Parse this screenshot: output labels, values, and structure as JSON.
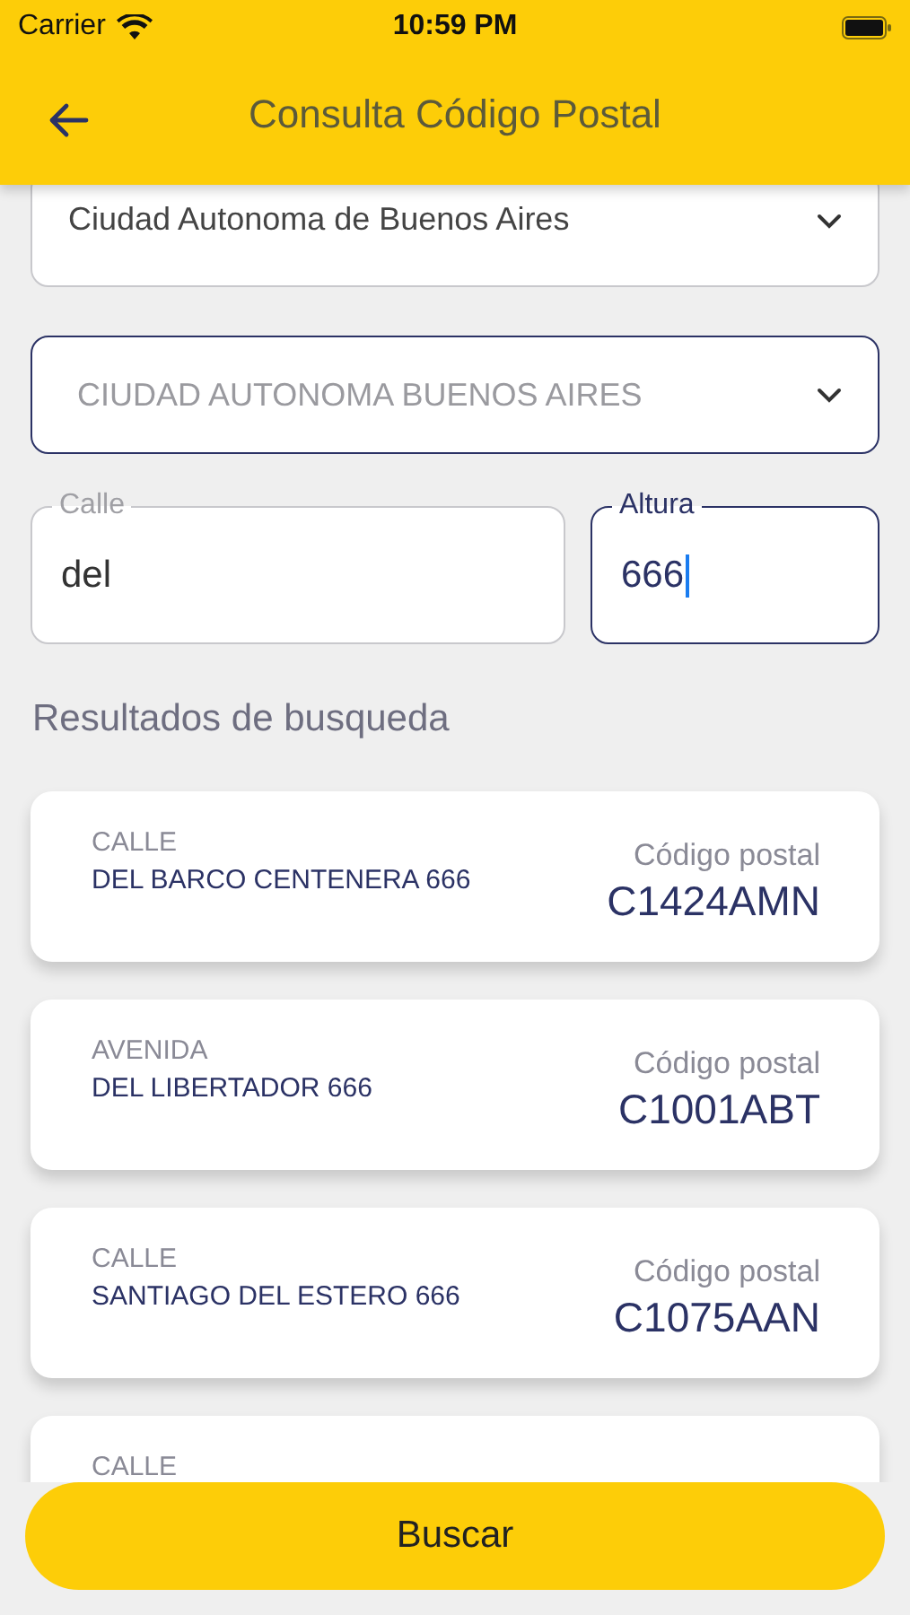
{
  "status_bar": {
    "carrier": "Carrier",
    "time": "10:59 PM"
  },
  "header": {
    "title": "Consulta Código Postal"
  },
  "province_select": {
    "value": "Ciudad Autonoma de Buenos Aires",
    "focused": false
  },
  "locality_select": {
    "value": "CIUDAD AUTONOMA BUENOS AIRES",
    "focused": true
  },
  "fields": [
    {
      "label": "Calle",
      "value": "del",
      "focused": false
    },
    {
      "label": "Altura",
      "value": "666",
      "focused": true
    }
  ],
  "results_heading": "Resultados de busqueda",
  "results": [
    {
      "type": "CALLE",
      "street": "DEL BARCO CENTENERA 666",
      "postal_label": "Código postal",
      "postal_code": "C1424AMN"
    },
    {
      "type": "AVENIDA",
      "street": "DEL LIBERTADOR 666",
      "postal_label": "Código postal",
      "postal_code": "C1001ABT"
    },
    {
      "type": "CALLE",
      "street": "SANTIAGO DEL ESTERO 666",
      "postal_label": "Código postal",
      "postal_code": "C1075AAN"
    },
    {
      "type": "CALLE"
    }
  ],
  "search_button": "Buscar"
}
